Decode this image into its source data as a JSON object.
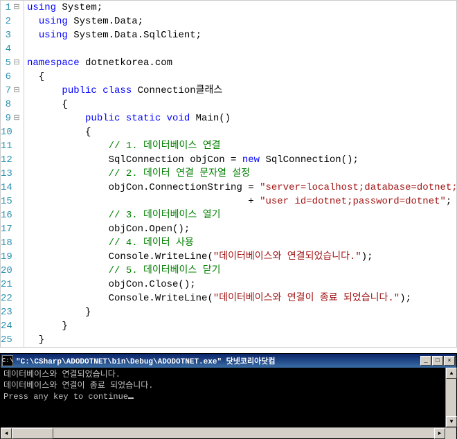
{
  "code": {
    "lines": [
      {
        "n": 1,
        "fold": "⊟",
        "tokens": [
          {
            "t": "using ",
            "c": "kw"
          },
          {
            "t": "System;",
            "c": ""
          }
        ]
      },
      {
        "n": 2,
        "fold": "",
        "tokens": [
          {
            "t": "  ",
            "c": ""
          },
          {
            "t": "using ",
            "c": "kw"
          },
          {
            "t": "System.Data;",
            "c": ""
          }
        ]
      },
      {
        "n": 3,
        "fold": "",
        "tokens": [
          {
            "t": "  ",
            "c": ""
          },
          {
            "t": "using ",
            "c": "kw"
          },
          {
            "t": "System.Data.SqlClient;",
            "c": ""
          }
        ]
      },
      {
        "n": 4,
        "fold": "",
        "tokens": [
          {
            "t": "",
            "c": ""
          }
        ]
      },
      {
        "n": 5,
        "fold": "⊟",
        "tokens": [
          {
            "t": "namespace ",
            "c": "kw"
          },
          {
            "t": "dotnetkorea.com",
            "c": ""
          }
        ]
      },
      {
        "n": 6,
        "fold": "",
        "tokens": [
          {
            "t": "  {",
            "c": ""
          }
        ]
      },
      {
        "n": 7,
        "fold": "⊟",
        "tokens": [
          {
            "t": "      ",
            "c": ""
          },
          {
            "t": "public class ",
            "c": "kw"
          },
          {
            "t": "Connection클래스",
            "c": ""
          }
        ]
      },
      {
        "n": 8,
        "fold": "",
        "tokens": [
          {
            "t": "      {",
            "c": ""
          }
        ]
      },
      {
        "n": 9,
        "fold": "⊟",
        "tokens": [
          {
            "t": "          ",
            "c": ""
          },
          {
            "t": "public static void ",
            "c": "kw"
          },
          {
            "t": "Main()",
            "c": ""
          }
        ]
      },
      {
        "n": 10,
        "fold": "",
        "tokens": [
          {
            "t": "          {",
            "c": ""
          }
        ]
      },
      {
        "n": 11,
        "fold": "",
        "tokens": [
          {
            "t": "              ",
            "c": ""
          },
          {
            "t": "// 1. 데이터베이스 연결",
            "c": "cm"
          }
        ]
      },
      {
        "n": 12,
        "fold": "",
        "tokens": [
          {
            "t": "              SqlConnection objCon = ",
            "c": ""
          },
          {
            "t": "new ",
            "c": "kw"
          },
          {
            "t": "SqlConnection();",
            "c": ""
          }
        ]
      },
      {
        "n": 13,
        "fold": "",
        "tokens": [
          {
            "t": "              ",
            "c": ""
          },
          {
            "t": "// 2. 데이터 연결 문자열 설정",
            "c": "cm"
          }
        ]
      },
      {
        "n": 14,
        "fold": "",
        "tokens": [
          {
            "t": "              objCon.ConnectionString = ",
            "c": ""
          },
          {
            "t": "\"server=localhost;database=dotnet;\"",
            "c": "str"
          }
        ]
      },
      {
        "n": 15,
        "fold": "",
        "tokens": [
          {
            "t": "                                      + ",
            "c": ""
          },
          {
            "t": "\"user id=dotnet;password=dotnet\"",
            "c": "str"
          },
          {
            "t": ";",
            "c": ""
          }
        ]
      },
      {
        "n": 16,
        "fold": "",
        "tokens": [
          {
            "t": "              ",
            "c": ""
          },
          {
            "t": "// 3. 데이터베이스 열기",
            "c": "cm"
          }
        ]
      },
      {
        "n": 17,
        "fold": "",
        "tokens": [
          {
            "t": "              objCon.Open();",
            "c": ""
          }
        ]
      },
      {
        "n": 18,
        "fold": "",
        "tokens": [
          {
            "t": "              ",
            "c": ""
          },
          {
            "t": "// 4. 데이터 사용",
            "c": "cm"
          }
        ]
      },
      {
        "n": 19,
        "fold": "",
        "tokens": [
          {
            "t": "              Console.WriteLine(",
            "c": ""
          },
          {
            "t": "\"데이터베이스와 연결되었습니다.\"",
            "c": "str"
          },
          {
            "t": ");",
            "c": ""
          }
        ]
      },
      {
        "n": 20,
        "fold": "",
        "tokens": [
          {
            "t": "              ",
            "c": ""
          },
          {
            "t": "// 5. 데이터베이스 닫기",
            "c": "cm"
          }
        ]
      },
      {
        "n": 21,
        "fold": "",
        "tokens": [
          {
            "t": "              objCon.Close();",
            "c": ""
          }
        ]
      },
      {
        "n": 22,
        "fold": "",
        "tokens": [
          {
            "t": "              Console.WriteLine(",
            "c": ""
          },
          {
            "t": "\"데이터베이스와 연결이 종료 되었습니다.\"",
            "c": "str"
          },
          {
            "t": ");",
            "c": ""
          }
        ]
      },
      {
        "n": 23,
        "fold": "",
        "tokens": [
          {
            "t": "          }",
            "c": ""
          }
        ]
      },
      {
        "n": 24,
        "fold": "",
        "tokens": [
          {
            "t": "      }",
            "c": ""
          }
        ]
      },
      {
        "n": 25,
        "fold": "",
        "tokens": [
          {
            "t": "  }",
            "c": ""
          }
        ]
      }
    ]
  },
  "console": {
    "icon": "C:\\",
    "title": "\"C:\\CSharp\\ADODOTNET\\bin\\Debug\\ADODOTNET.exe\" 닷넷코리아닷컴",
    "lines": [
      "데이터베이스와 연결되었습니다.",
      "데이터베이스와 연결이 종료 되었습니다.",
      "",
      "Press any key to continue"
    ],
    "buttons": {
      "min": "_",
      "max": "□",
      "close": "×"
    },
    "arrows": {
      "up": "▲",
      "down": "▼",
      "left": "◄",
      "right": "►"
    }
  }
}
